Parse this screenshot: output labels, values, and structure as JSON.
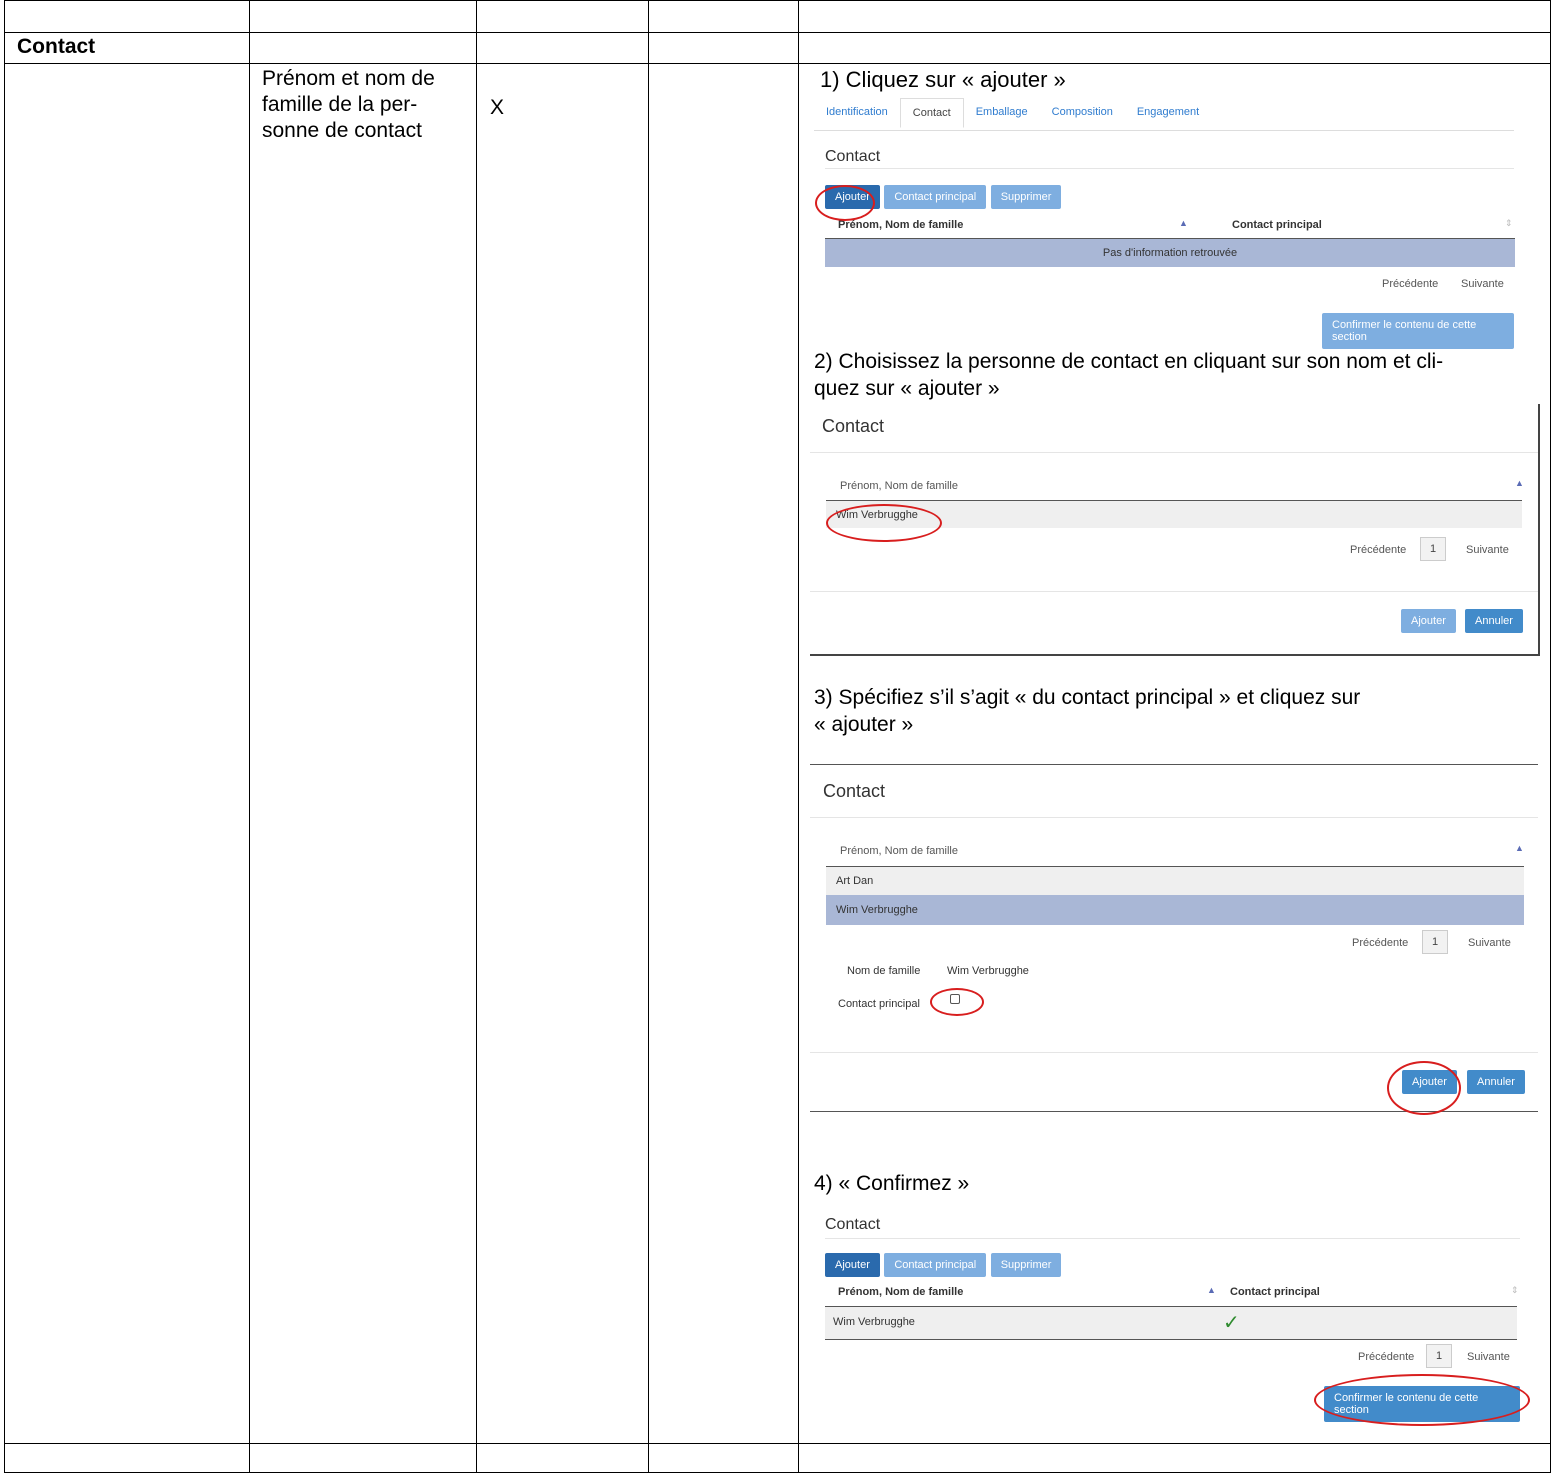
{
  "section_title": "Contact",
  "field_label": "Prénom et nom de famille de la personne de contact",
  "field_label_lines": [
    "Prénom et nom de",
    "famille de la per-",
    "sonne de contact"
  ],
  "mandatory_mark": "X",
  "steps": {
    "s1": "1) Cliquez sur « ajouter »",
    "s2a": "2) Choisissez la personne de contact en cliquant sur son nom et cli-",
    "s2b": "quez sur « ajouter »",
    "s3a": "3) Spécifiez s’il s’agit « du contact principal » et cliquez sur",
    "s3b": "« ajouter »",
    "s4": "4) « Confirmez »"
  },
  "shot1": {
    "tabs": [
      "Identification",
      "Contact",
      "Emballage",
      "Composition",
      "Engagement"
    ],
    "title": "Contact",
    "buttons": {
      "add": "Ajouter",
      "main": "Contact principal",
      "delete": "Supprimer"
    },
    "col_name": "Prénom, Nom de famille",
    "col_main": "Contact principal",
    "empty": "Pas d'information retrouvée",
    "prev": "Précédente",
    "next": "Suivante",
    "confirm": "Confirmer le contenu de cette section"
  },
  "shot2": {
    "title": "Contact",
    "col_name": "Prénom, Nom de famille",
    "row": "Wim Verbrugghe",
    "prev": "Précédente",
    "page": "1",
    "next": "Suivante",
    "add": "Ajouter",
    "cancel": "Annuler"
  },
  "shot3": {
    "title": "Contact",
    "col_name": "Prénom, Nom de famille",
    "rows": [
      "Art Dan",
      "Wim Verbrugghe"
    ],
    "prev": "Précédente",
    "page": "1",
    "next": "Suivante",
    "lastname_label": "Nom de famille",
    "lastname_value": "Wim Verbrugghe",
    "main_label": "Contact principal",
    "add": "Ajouter",
    "cancel": "Annuler"
  },
  "shot4": {
    "title": "Contact",
    "buttons": {
      "add": "Ajouter",
      "main": "Contact principal",
      "delete": "Supprimer"
    },
    "col_name": "Prénom, Nom de famille",
    "col_main": "Contact principal",
    "row": "Wim Verbrugghe",
    "check": "✓",
    "prev": "Précédente",
    "page": "1",
    "next": "Suivante",
    "confirm": "Confirmer le contenu de cette section"
  },
  "colors": {
    "ring": "#d81e1e",
    "accent": "#428bca",
    "selected_row": "#a9b7d6"
  }
}
